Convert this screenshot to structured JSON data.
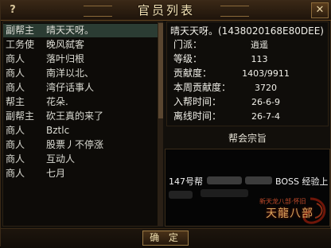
{
  "window": {
    "title": "官员列表",
    "help_label": "?",
    "close_label": "✕"
  },
  "members": [
    {
      "rank": "副帮主",
      "name": "晴天天呀。"
    },
    {
      "rank": "工务使",
      "name": "晚风弑客"
    },
    {
      "rank": "商人",
      "name": "落叶归根"
    },
    {
      "rank": "商人",
      "name": "南洋以北、"
    },
    {
      "rank": "商人",
      "name": "湾仔话事人"
    },
    {
      "rank": "帮主",
      "name": "花朵."
    },
    {
      "rank": "副帮主",
      "name": "砍王真的来了"
    },
    {
      "rank": "商人",
      "name": "Bztlc"
    },
    {
      "rank": "商人",
      "name": "股票丿不停涨"
    },
    {
      "rank": "商人",
      "name": "互动人"
    },
    {
      "rank": "商人",
      "name": "七月"
    }
  ],
  "selected_member_index": 0,
  "info": {
    "header": "晴天天呀。(1438020168E80DEE)",
    "rows": [
      {
        "label": "门派：",
        "value": "逍遥"
      },
      {
        "label": "等级：",
        "value": "113"
      },
      {
        "label": "贡献度：",
        "value": "1403/9911"
      },
      {
        "label": "本周贡献度：",
        "value": "3720"
      },
      {
        "label": "入帮时间：",
        "value": "26-6-9"
      },
      {
        "label": "离线时间：",
        "value": "26-7-4"
      }
    ]
  },
  "motto": {
    "title": "帮会宗旨",
    "text_start": "147号帮",
    "text_end": "BOSS 经验上"
  },
  "logo": {
    "small_text": "新天龙八部·怀旧",
    "main_text": "天龍八部"
  },
  "footer": {
    "ok_label": "确 定"
  },
  "colors": {
    "selected_row": "#2b3c33",
    "title_text": "#f3e2b5",
    "text": "#dcdcd4"
  }
}
